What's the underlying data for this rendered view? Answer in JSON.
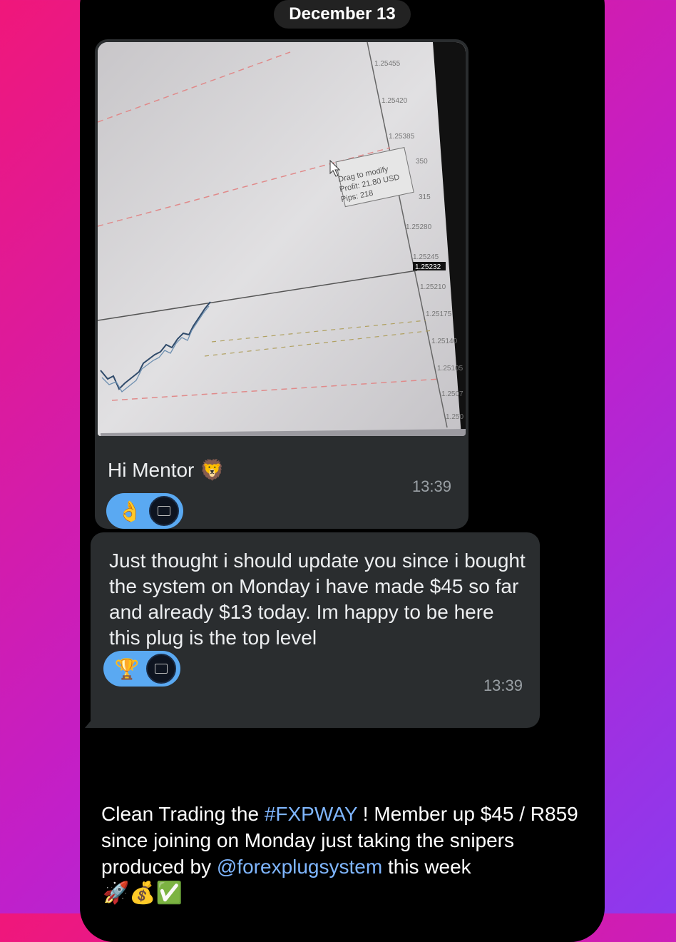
{
  "date_header": "December 13",
  "message1": {
    "photo_overlay": {
      "line1": "Drag to modify",
      "line2": "Profit: 21.80 USD",
      "line3": "Pips: 218"
    },
    "price_labels": [
      "1.25455",
      "1.25420",
      "1.25385",
      "350",
      "315",
      "1.25280",
      "1.25245",
      "1.25232",
      "1.25210",
      "1.25175",
      "1.25140",
      "1.25105",
      "1.2507",
      "1.250"
    ],
    "text": "Hi Mentor",
    "text_emoji": "🦁",
    "reaction_emoji": "👌",
    "time": "13:39"
  },
  "message2": {
    "text": "Just thought i should update you since i bought the system on Monday i have made $45 so far and already $13 today. Im happy to be here this plug is the top level",
    "trailing_emoji": "🤞",
    "reaction_emoji": "🏆",
    "time": "13:39"
  },
  "caption": {
    "part1": "Clean Trading the ",
    "hashtag": "#FXPWAY",
    "part2": " ! Member up $45 / R859 since joining on Monday just taking the snipers produced by ",
    "mention": "@forexplugsystem",
    "part3": " this week",
    "emojis": "🚀💰✅"
  },
  "colors": {
    "bubble": "#2a2d2f",
    "reaction_pill": "#5aa9f2",
    "link": "#7fb6ff"
  }
}
